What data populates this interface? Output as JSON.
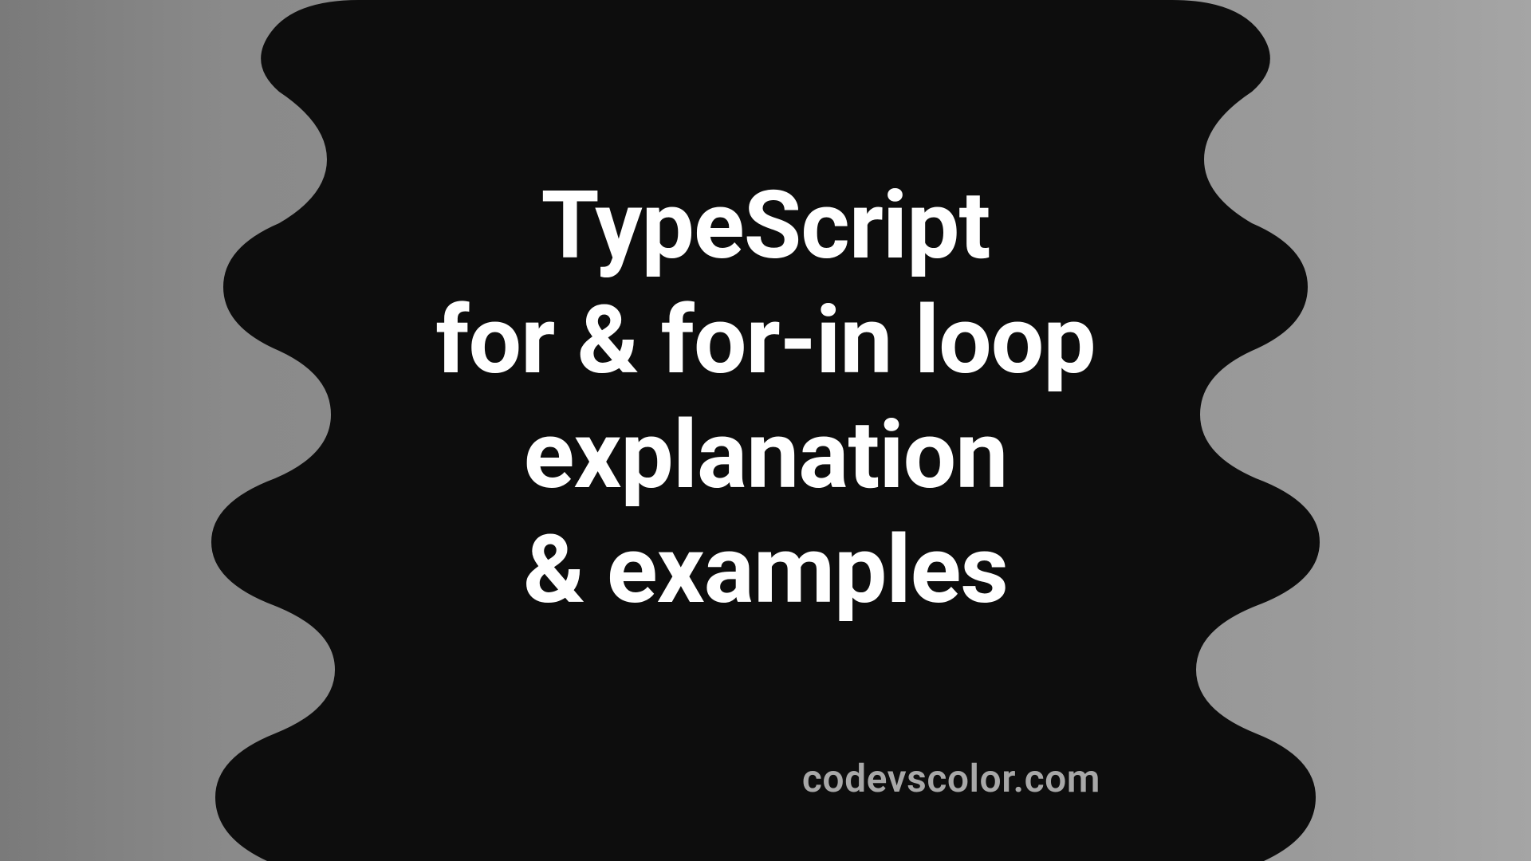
{
  "title": {
    "line1": "TypeScript",
    "line2": "for & for-in loop",
    "line3": "explanation",
    "line4": "& examples"
  },
  "attribution": "codevscolor.com",
  "colors": {
    "blob": "#0d0d0d",
    "text": "#ffffff",
    "attribution": "#a8a8a8",
    "bg_gradient_start": "#7a7a7a",
    "bg_gradient_end": "#a5a5a5"
  }
}
